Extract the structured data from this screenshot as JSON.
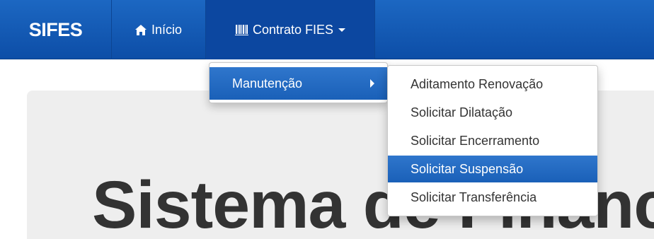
{
  "navbar": {
    "brand": "SIFES",
    "inicio_label": "Início",
    "contrato_label": "Contrato FIES",
    "icons": {
      "inicio": "home-icon",
      "contrato": "barcode-icon"
    }
  },
  "menu": {
    "manutencao_label": "Manutenção",
    "submenu": [
      {
        "label": "Aditamento Renovação",
        "active": false
      },
      {
        "label": "Solicitar Dilatação",
        "active": false
      },
      {
        "label": "Solicitar Encerramento",
        "active": false
      },
      {
        "label": "Solicitar Suspensão",
        "active": true
      },
      {
        "label": "Solicitar Transferência",
        "active": false
      }
    ]
  },
  "jumbotron": {
    "title": "Sistema de Financ"
  },
  "colors": {
    "navbar": "#1c67c2",
    "active_item": "#2f76cc",
    "jumbotron_bg": "#eeeeee"
  }
}
